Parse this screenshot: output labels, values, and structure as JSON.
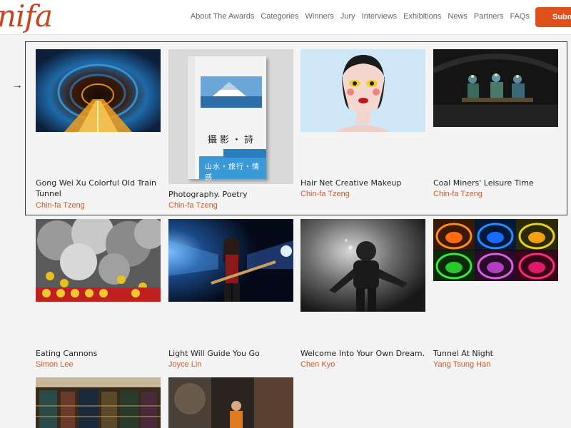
{
  "header": {
    "logo_text": "nifa",
    "nav": [
      "About The Awards",
      "Categories",
      "Winners",
      "Jury",
      "Interviews",
      "Exhibitions",
      "News",
      "Partners",
      "FAQs"
    ],
    "submit_label": "Submit"
  },
  "ui": {
    "arrow": "→"
  },
  "book": {
    "title": "攝影・詩",
    "subtitle": "山水・旅行・情感"
  },
  "gallery": [
    {
      "title": "Gong Wei Xu Colorful Old Train Tunnel",
      "author": "Chin-fa Tzeng"
    },
    {
      "title": "Photography. Poetry",
      "author": "Chin-fa Tzeng"
    },
    {
      "title": "Hair Net Creative Makeup",
      "author": "Chin-fa Tzeng"
    },
    {
      "title": "Coal Miners' Leisure Time",
      "author": "Chin-fa Tzeng"
    },
    {
      "title": "Eating Cannons",
      "author": "Simon Lee"
    },
    {
      "title": "Light Will Guide You Go",
      "author": "Joyce Lin"
    },
    {
      "title": "Welcome Into Your Own Dream.",
      "author": "Chen Kyo"
    },
    {
      "title": "Tunnel At Night",
      "author": "Yang Tsung Han"
    }
  ]
}
